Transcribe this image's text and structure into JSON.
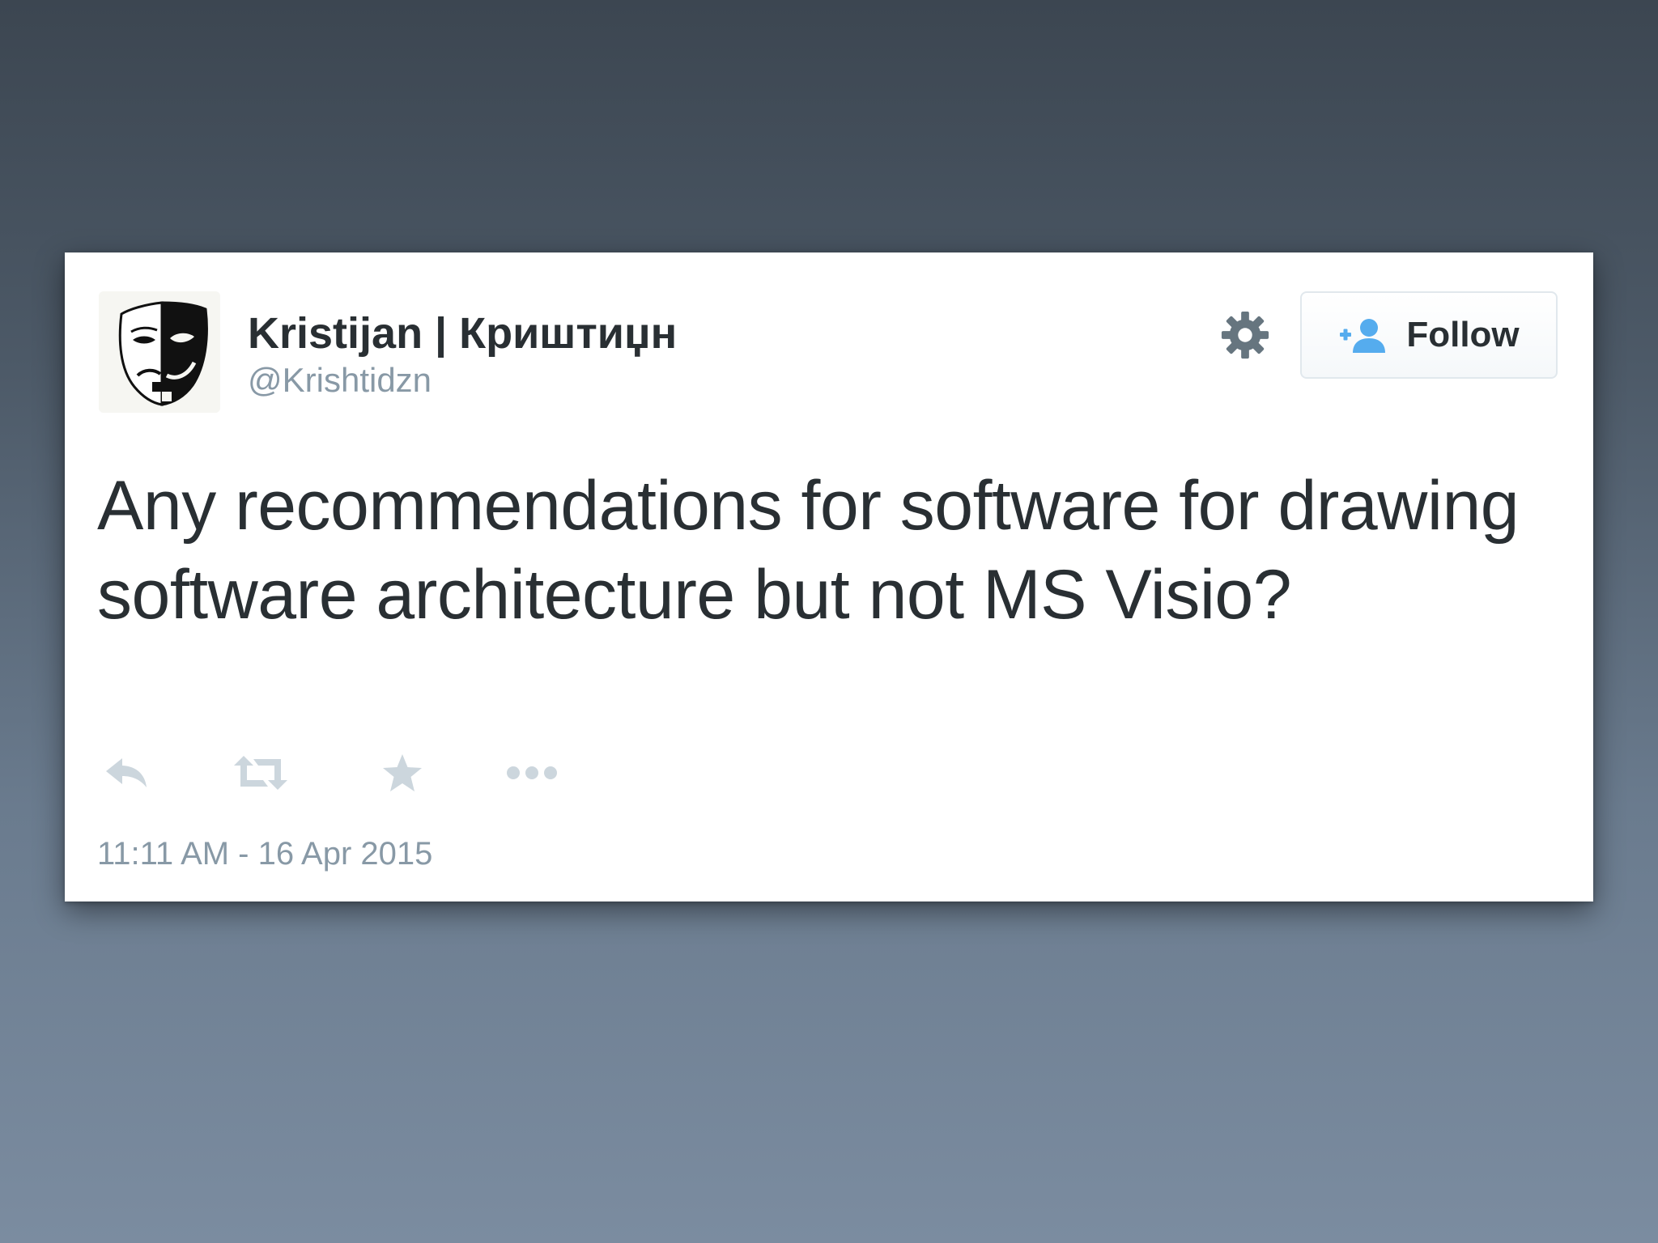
{
  "tweet": {
    "user": {
      "display_name": "Kristijan | Криштиџн",
      "handle": "@Krishtidzn",
      "avatar_icon": "theater-mask-icon"
    },
    "settings_icon": "gear-icon",
    "follow_button": {
      "label": "Follow",
      "icon": "add-user-icon",
      "accent_color": "#55acee"
    },
    "text": "Any recommendations for software for drawing software architecture but not MS Visio?",
    "actions": [
      {
        "name": "reply",
        "icon": "reply-icon"
      },
      {
        "name": "retweet",
        "icon": "retweet-icon"
      },
      {
        "name": "favorite",
        "icon": "star-icon"
      },
      {
        "name": "more",
        "icon": "ellipsis-icon"
      }
    ],
    "timestamp": "11:11 AM - 16 Apr 2015"
  },
  "colors": {
    "text_primary": "#292f33",
    "text_secondary": "#8899a6",
    "icon_gray": "#ccd6dd",
    "card_background": "#ffffff"
  }
}
